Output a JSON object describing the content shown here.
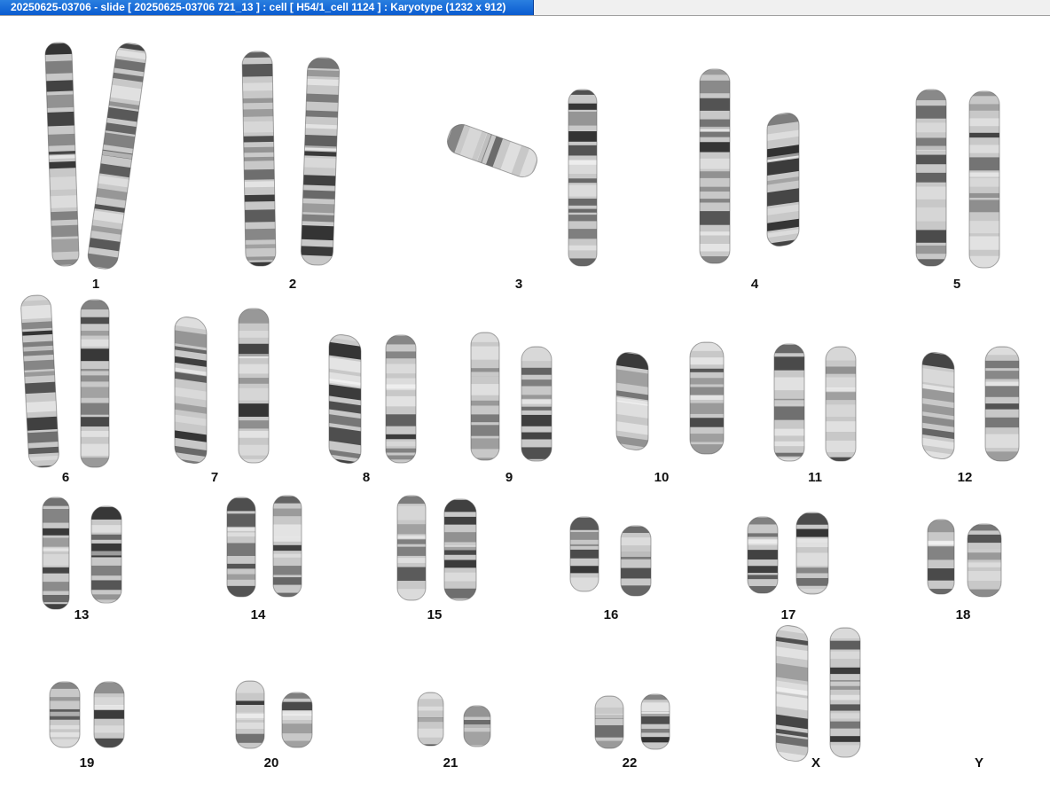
{
  "window": {
    "title": "20250625-03706 - slide [ 20250625-03706 721_13 ] : cell [ H54/1_cell 1124 ] : Karyotype  (1232 x 912)"
  },
  "karyotype": {
    "chromosomes": [
      {
        "label": "1",
        "count": 2
      },
      {
        "label": "2",
        "count": 2
      },
      {
        "label": "3",
        "count": 2
      },
      {
        "label": "4",
        "count": 2
      },
      {
        "label": "5",
        "count": 2
      },
      {
        "label": "6",
        "count": 2
      },
      {
        "label": "7",
        "count": 2
      },
      {
        "label": "8",
        "count": 2
      },
      {
        "label": "9",
        "count": 2
      },
      {
        "label": "10",
        "count": 2
      },
      {
        "label": "11",
        "count": 2
      },
      {
        "label": "12",
        "count": 2
      },
      {
        "label": "13",
        "count": 2
      },
      {
        "label": "14",
        "count": 2
      },
      {
        "label": "15",
        "count": 2
      },
      {
        "label": "16",
        "count": 2
      },
      {
        "label": "17",
        "count": 2
      },
      {
        "label": "18",
        "count": 2
      },
      {
        "label": "19",
        "count": 2
      },
      {
        "label": "20",
        "count": 2
      },
      {
        "label": "21",
        "count": 2
      },
      {
        "label": "22",
        "count": 2
      },
      {
        "label": "X",
        "count": 2
      },
      {
        "label": "Y",
        "count": 0
      }
    ]
  },
  "colors": {
    "titlebar": "#0a5bd0",
    "chromosome_light": "#c8c8c8",
    "chromosome_dark": "#2a2a2a"
  }
}
